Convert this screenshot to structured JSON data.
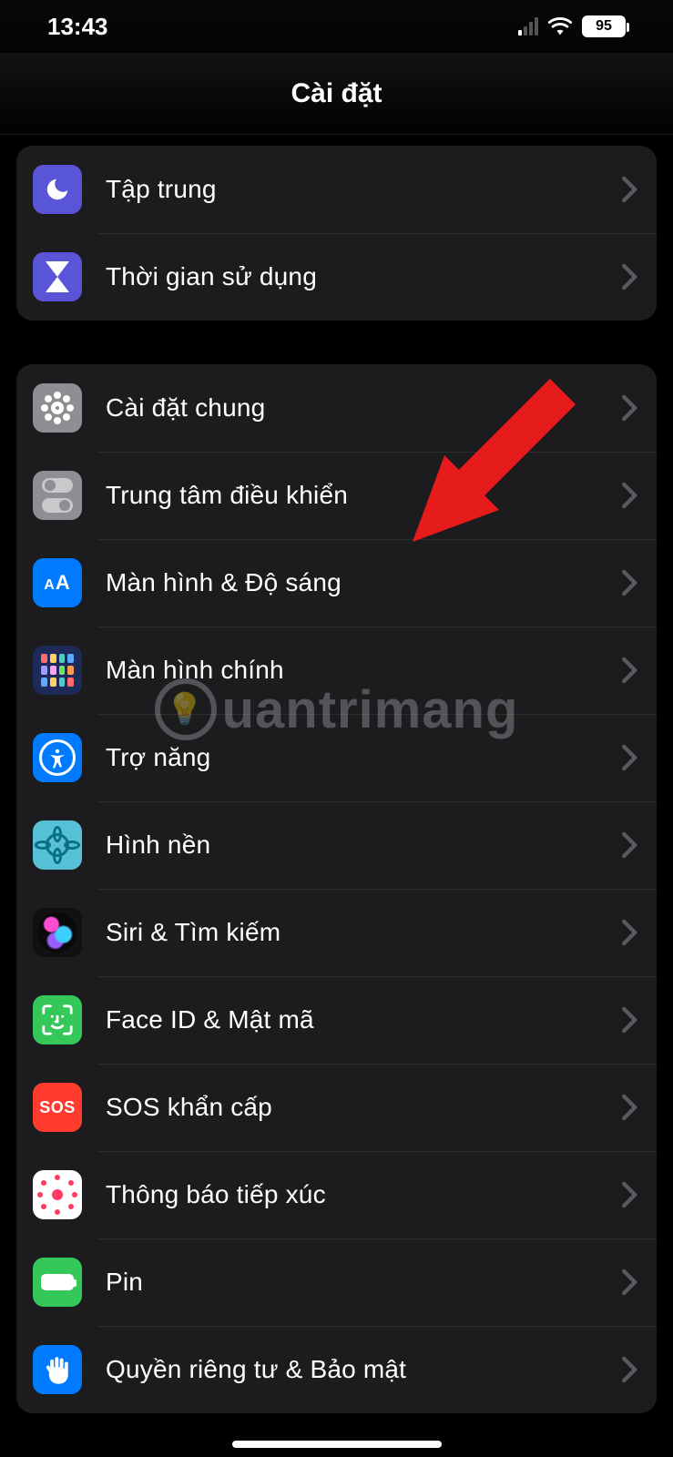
{
  "status": {
    "time": "13:43",
    "battery_pct": "95"
  },
  "header": {
    "title": "Cài đặt"
  },
  "group1": {
    "items": [
      {
        "label": "Tập trung",
        "icon": "moon-icon"
      },
      {
        "label": "Thời gian sử dụng",
        "icon": "hourglass-icon"
      }
    ]
  },
  "group2": {
    "items": [
      {
        "label": "Cài đặt chung",
        "icon": "gear-icon"
      },
      {
        "label": "Trung tâm điều khiển",
        "icon": "toggles-icon"
      },
      {
        "label": "Màn hình & Độ sáng",
        "icon": "text-size-icon"
      },
      {
        "label": "Màn hình chính",
        "icon": "home-grid-icon"
      },
      {
        "label": "Trợ năng",
        "icon": "accessibility-icon"
      },
      {
        "label": "Hình nền",
        "icon": "wallpaper-icon"
      },
      {
        "label": "Siri & Tìm kiếm",
        "icon": "siri-icon"
      },
      {
        "label": "Face ID & Mật mã",
        "icon": "faceid-icon"
      },
      {
        "label": "SOS khẩn cấp",
        "icon": "sos-icon"
      },
      {
        "label": "Thông báo tiếp xúc",
        "icon": "exposure-icon"
      },
      {
        "label": "Pin",
        "icon": "battery-icon"
      },
      {
        "label": "Quyền riêng tư & Bảo mật",
        "icon": "hand-icon"
      }
    ]
  },
  "watermark": {
    "text": "uantrimang"
  },
  "annotation": {
    "points_to": "Màn hình & Độ sáng"
  }
}
